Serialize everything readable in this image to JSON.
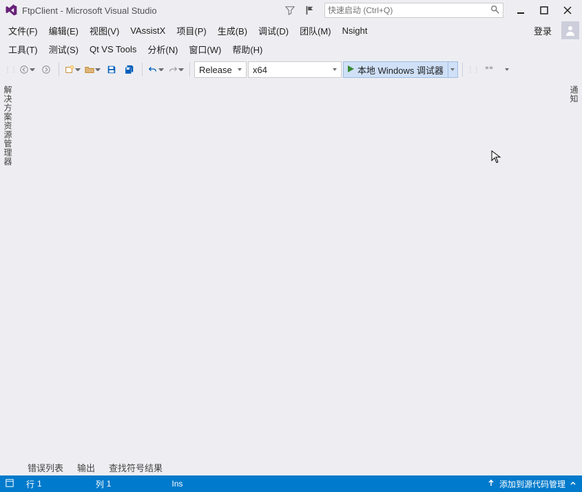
{
  "title": "FtpClient - Microsoft Visual Studio",
  "search": {
    "placeholder": "快速启动 (Ctrl+Q)"
  },
  "menu1": {
    "file": "文件(F)",
    "edit": "编辑(E)",
    "view": "视图(V)",
    "vassistx": "VAssistX",
    "project": "项目(P)",
    "build": "生成(B)",
    "debug": "调试(D)",
    "team": "团队(M)",
    "nsight": "Nsight",
    "login": "登录"
  },
  "menu2": {
    "tools": "工具(T)",
    "test": "测试(S)",
    "qt": "Qt VS Tools",
    "analyze": "分析(N)",
    "window": "窗口(W)",
    "help": "帮助(H)"
  },
  "toolbar": {
    "config": "Release",
    "platform": "x64",
    "debug_label": "本地 Windows 调试器"
  },
  "side": {
    "solution_explorer": "解决方案资源管理器",
    "notifications": "通知"
  },
  "bottom_tabs": {
    "error_list": "错误列表",
    "output": "输出",
    "find_symbol": "查找符号结果"
  },
  "status": {
    "line_label": "行",
    "line_val": "1",
    "col_label": "列",
    "col_val": "1",
    "ins": "Ins",
    "source_control": "添加到源代码管理"
  }
}
